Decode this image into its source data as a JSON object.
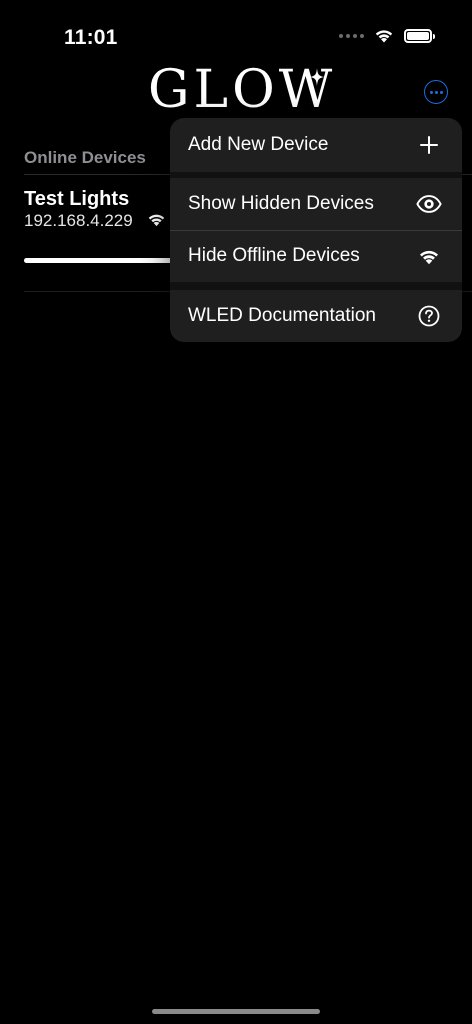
{
  "status_bar": {
    "time": "11:01"
  },
  "header": {
    "logo_text": "GLOW",
    "more_icon": "ellipsis-circle-icon",
    "accent_color": "#1b6fe0"
  },
  "devices_section": {
    "title": "Online Devices",
    "devices": [
      {
        "name": "Test Lights",
        "ip": "192.168.4.229",
        "status_icon": "wifi-icon",
        "brightness_fraction": 0.9
      }
    ]
  },
  "context_menu": {
    "items": [
      {
        "label": "Add New Device",
        "icon": "plus-icon"
      },
      {
        "label": "Show Hidden Devices",
        "icon": "eye-icon"
      },
      {
        "label": "Hide Offline Devices",
        "icon": "wifi-icon"
      },
      {
        "label": "WLED Documentation",
        "icon": "question-circle-icon"
      }
    ]
  }
}
